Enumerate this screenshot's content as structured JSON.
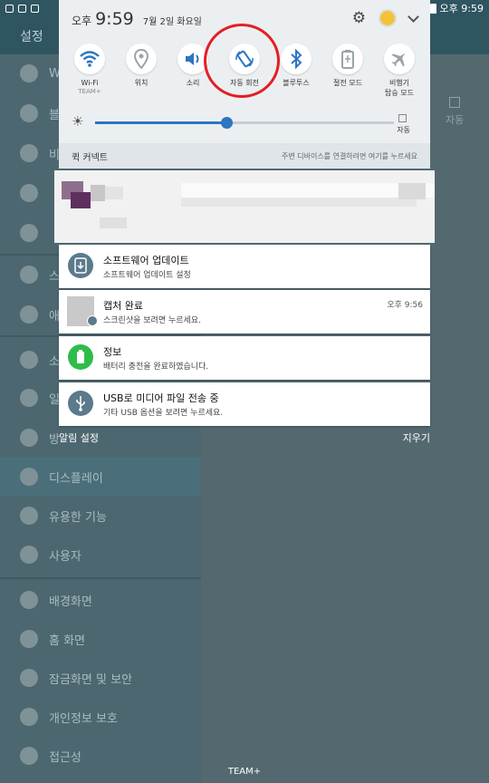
{
  "status_bar": {
    "time": "오후 9:59"
  },
  "background_app": {
    "header_title": "설정",
    "items": [
      {
        "label": "W"
      },
      {
        "label": "블"
      },
      {
        "label": "비"
      },
      {
        "label": ""
      },
      {
        "label": ""
      },
      {
        "label": "스"
      },
      {
        "label": "애"
      },
      {
        "label": "소"
      },
      {
        "label": "일"
      },
      {
        "label": "방"
      },
      {
        "label": "디스플레이"
      },
      {
        "label": "유용한 기능"
      },
      {
        "label": "사용자"
      },
      {
        "label": "배경화면"
      },
      {
        "label": "홈 화면"
      },
      {
        "label": "잠금화면 및 보안"
      },
      {
        "label": "개인정보 보호"
      },
      {
        "label": "접근성"
      }
    ],
    "right_label": "자동"
  },
  "shade": {
    "ampm": "오후",
    "time": "9:59",
    "date": "7월 2일 화요일",
    "quick_settings": [
      {
        "label": "Wi-Fi",
        "sub": "TEAM+",
        "icon": "wifi-icon"
      },
      {
        "label": "위치",
        "sub": "",
        "icon": "location-icon"
      },
      {
        "label": "소리",
        "sub": "",
        "icon": "sound-icon"
      },
      {
        "label": "자동 회전",
        "sub": "",
        "icon": "auto-rotate-icon"
      },
      {
        "label": "블루투스",
        "sub": "",
        "icon": "bluetooth-icon"
      },
      {
        "label": "절전 모드",
        "sub": "",
        "icon": "power-saving-icon"
      },
      {
        "label": "비행기\n탑승 모드",
        "sub": "",
        "icon": "airplane-icon"
      }
    ],
    "brightness": {
      "auto_label": "자동",
      "level": 0.44
    },
    "quick_connect": {
      "title": "퀵 커넥트",
      "hint": "주변 디바이스를 연결하려면 여기를 누르세요"
    }
  },
  "notifications": [
    {
      "title": "소프트웨어 업데이트",
      "sub": "소프트웨어 업데이트 설정",
      "time": "",
      "icon": "software-update-icon",
      "icon_color": "#5b7a8c"
    },
    {
      "title": "캡처 완료",
      "sub": "스크린샷을 보려면 누르세요.",
      "time": "오후 9:56",
      "icon": "screenshot-thumbnail-icon",
      "icon_color": "#bbbbbb"
    },
    {
      "title": "정보",
      "sub": "배터리 충전을 완료하였습니다.",
      "time": "",
      "icon": "battery-full-icon",
      "icon_color": "#2ebd4a"
    },
    {
      "title": "USB로 미디어 파일 전송 중",
      "sub": "기타 USB 옵션을 보려면 누르세요.",
      "time": "",
      "icon": "usb-icon",
      "icon_color": "#5b7a8c"
    }
  ],
  "footer": {
    "left": "알림 설정",
    "right": "지우기"
  },
  "bottom_label": "TEAM+",
  "colors": {
    "accent": "#2c76c2",
    "highlight_circle": "#e41e25"
  }
}
